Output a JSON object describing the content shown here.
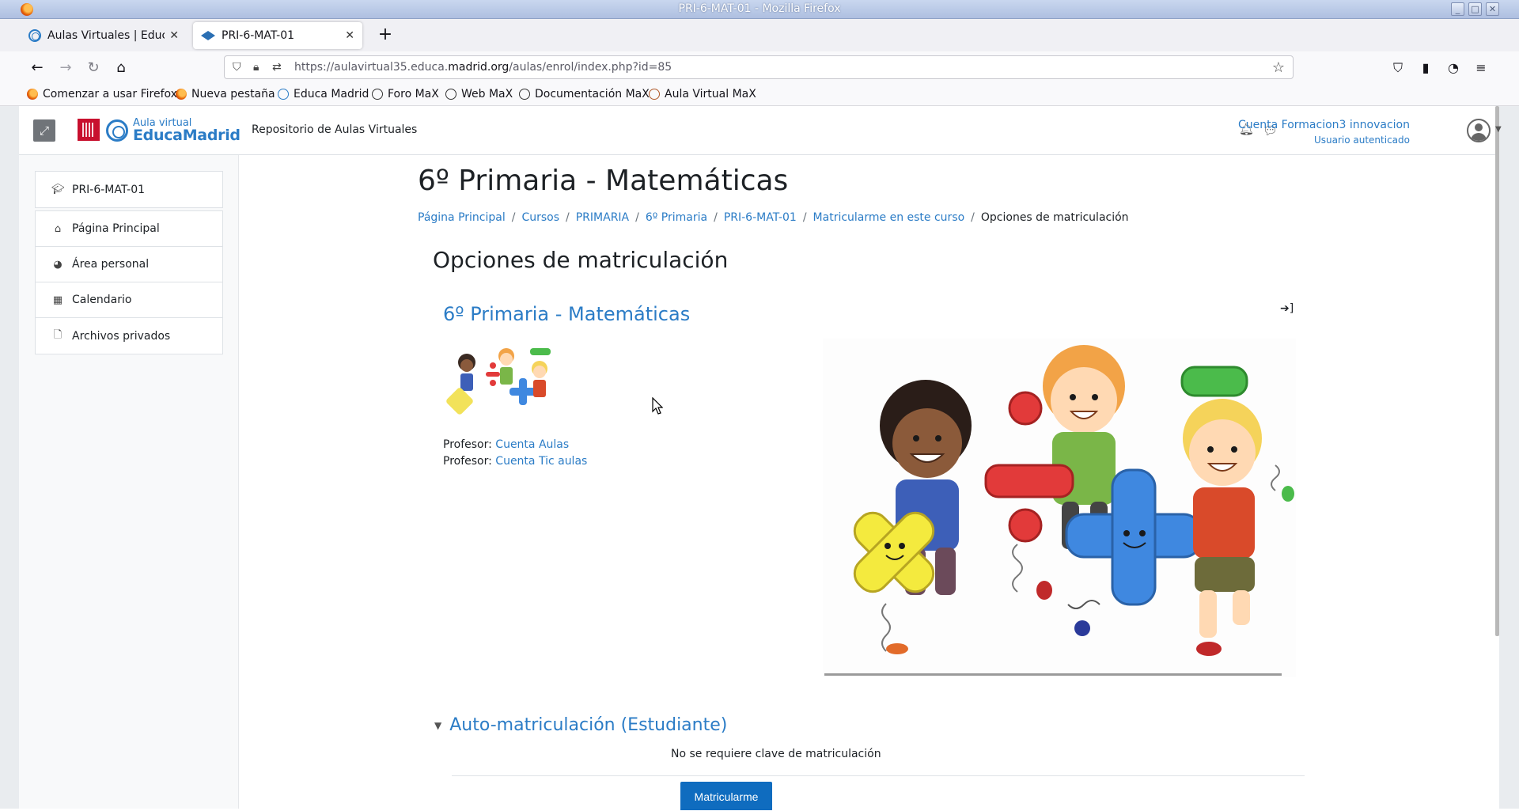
{
  "window": {
    "title": "PRI-6-MAT-01 - Mozilla Firefox"
  },
  "tabs": [
    {
      "label": "Aulas Virtuales | EducaMadrid",
      "active": false
    },
    {
      "label": "PRI-6-MAT-01",
      "active": true
    }
  ],
  "urlbar": {
    "url_prefix": "https://aulavirtual35.educa.",
    "url_domain": "madrid.org",
    "url_path": "/aulas/enrol/index.php?id=85"
  },
  "bookmarks": [
    {
      "label": "Comenzar a usar Firefox"
    },
    {
      "label": "Nueva pestaña"
    },
    {
      "label": "Educa Madrid"
    },
    {
      "label": "Foro MaX"
    },
    {
      "label": "Web MaX"
    },
    {
      "label": "Documentación MaX"
    },
    {
      "label": "Aula Virtual MaX"
    }
  ],
  "header": {
    "logo_small": "Aula virtual",
    "logo_big": "EducaMadrid",
    "site_name": "Repositorio de Aulas Virtuales",
    "user_name": "Cuenta Formacion3 innovacion",
    "user_role": "Usuario autenticado"
  },
  "drawer": {
    "course_item": "PRI-6-MAT-01",
    "items": [
      {
        "label": "Página Principal",
        "icon": "home-icon"
      },
      {
        "label": "Área personal",
        "icon": "dashboard-icon"
      },
      {
        "label": "Calendario",
        "icon": "calendar-icon"
      },
      {
        "label": "Archivos privados",
        "icon": "file-icon"
      }
    ]
  },
  "main": {
    "page_title": "6º Primaria - Matemáticas",
    "breadcrumb": [
      "Página Principal",
      "Cursos",
      "PRIMARIA",
      "6º Primaria",
      "PRI-6-MAT-01",
      "Matricularme en este curso",
      "Opciones de matriculación"
    ],
    "section_heading": "Opciones de matriculación",
    "course_link": "6º Primaria - Matemáticas",
    "teachers": [
      {
        "role": "Profesor: ",
        "name": "Cuenta Aulas"
      },
      {
        "role": "Profesor: ",
        "name": "Cuenta Tic aulas"
      }
    ],
    "self_enrol_heading": "Auto-matriculación (Estudiante)",
    "no_key_text": "No se requiere clave de matriculación",
    "enrol_button": "Matricularme"
  },
  "colors": {
    "link": "#2b7cc6",
    "primary_button": "#0f6cbf",
    "text": "#1d2125"
  }
}
